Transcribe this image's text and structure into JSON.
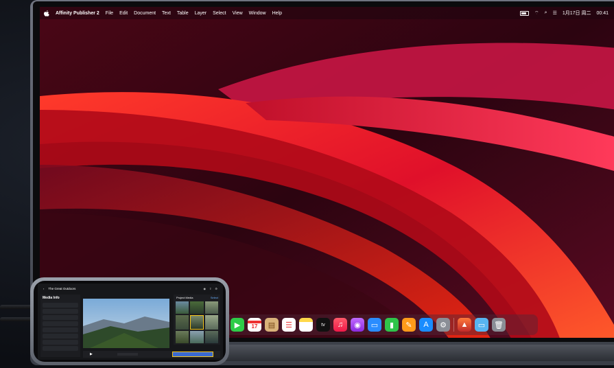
{
  "menubar": {
    "app_name": "Affinity Publisher 2",
    "menus": [
      "File",
      "Edit",
      "Document",
      "Text",
      "Table",
      "Layer",
      "Select",
      "View",
      "Window",
      "Help"
    ],
    "date": "1月17日 周二",
    "time": "00:41"
  },
  "dock": {
    "calendar_day": "17",
    "icons": [
      "facetime-icon",
      "calendar-icon",
      "notes-icon",
      "reminders-icon",
      "notes-yellow-icon",
      "apple-tv-icon",
      "music-icon",
      "podcasts-icon",
      "keynote-icon",
      "numbers-icon",
      "pages-icon",
      "app-store-icon",
      "system-settings-icon",
      "affinity-publisher-icon",
      "finder-folder-icon",
      "trash-icon"
    ]
  },
  "phone": {
    "project_title": "The Great Outdoors",
    "inspector_title": "Media Info",
    "browser_title": "Project Media",
    "select_label": "Select"
  },
  "colors": {
    "wallpaper_dark": "#3a0410",
    "wallpaper_red": "#ff2a1a",
    "dock_bg": "rgba(80,40,55,0.45)"
  }
}
